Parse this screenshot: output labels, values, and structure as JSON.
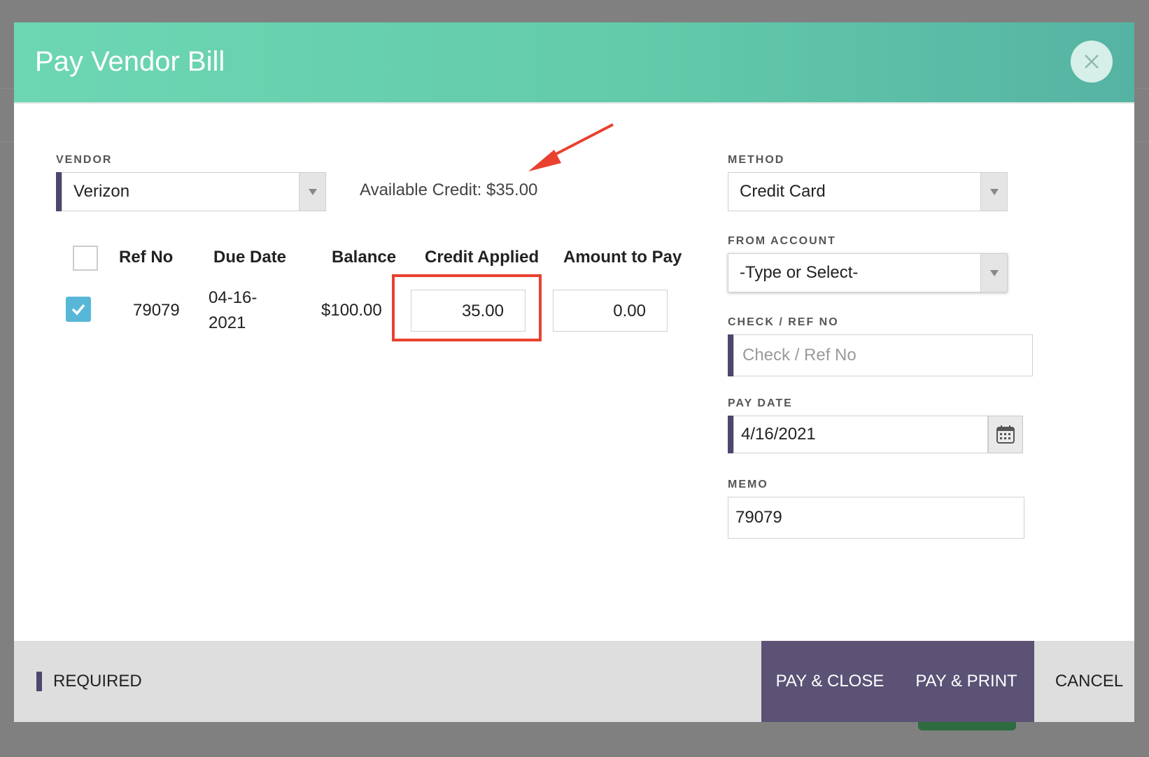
{
  "dialog": {
    "title": "Pay Vendor Bill"
  },
  "vendor": {
    "label": "VENDOR",
    "value": "Verizon",
    "available_credit": "Available Credit: $35.00"
  },
  "table": {
    "headers": [
      "Ref No",
      "Due Date",
      "Balance",
      "Credit Applied",
      "Amount to Pay"
    ],
    "rows": [
      {
        "checked": true,
        "ref_no": "79079",
        "due_date_line1": "04-16-",
        "due_date_line2": "2021",
        "balance": "$100.00",
        "credit_applied": "35.00",
        "amount_to_pay": "0.00"
      }
    ]
  },
  "method": {
    "label": "METHOD",
    "value": "Credit Card"
  },
  "from_account": {
    "label": "FROM ACCOUNT",
    "value": "-Type or Select-"
  },
  "check_ref": {
    "label": "CHECK / REF NO",
    "placeholder": "Check / Ref No"
  },
  "pay_date": {
    "label": "PAY DATE",
    "value": "4/16/2021"
  },
  "memo": {
    "label": "MEMO",
    "value": "79079"
  },
  "footer": {
    "required_label": "REQUIRED",
    "pay_close": "PAY & CLOSE",
    "pay_print": "PAY & PRINT",
    "cancel": "CANCEL"
  },
  "colors": {
    "header": "#63cbaa",
    "accent_purple": "#5b5275",
    "highlight_red": "#e8422f",
    "checkbox_blue": "#58b7d6"
  }
}
